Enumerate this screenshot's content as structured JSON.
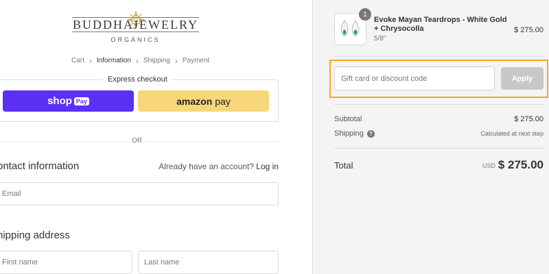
{
  "brand": {
    "word1": "BUDDHA",
    "word2": "JEWELRY",
    "sub": "ORGANICS",
    "colors": {
      "accent": "#c79a3b"
    }
  },
  "breadcrumb": {
    "items": [
      {
        "label": "Cart"
      },
      {
        "label": "Information",
        "current": true
      },
      {
        "label": "Shipping"
      },
      {
        "label": "Payment"
      }
    ],
    "separator_icon": "chevron-right-icon"
  },
  "express": {
    "title": "Express checkout",
    "shoppay_label": "shop",
    "shoppay_badge": "Pay",
    "amazon_label": "amazon",
    "amazon_pay": "pay",
    "colors": {
      "shoppay": "#5a31f4",
      "amazonpay": "#f8d67a"
    }
  },
  "divider": {
    "or": "OR"
  },
  "contact": {
    "title": "ontact information",
    "account_prompt": "Already have an account?",
    "login_link": "Log in",
    "email_placeholder": "Email"
  },
  "shipping_address": {
    "title": "hipping address",
    "first_name_placeholder": "First name",
    "last_name_placeholder": "Last name"
  },
  "order": {
    "product": {
      "name": "Evoke Mayan Teardrops - White Gold + Chrysocolla",
      "variant": "5/8\"",
      "price": "$ 275.00",
      "quantity": "1"
    },
    "discount": {
      "placeholder": "Gift card or discount code",
      "apply_label": "Apply",
      "highlight_color": "#f5a623"
    },
    "subtotal": {
      "label": "Subtotal",
      "value": "$ 275.00"
    },
    "shipping": {
      "label": "Shipping",
      "value": "Calculated at next step",
      "help_icon": "question-icon"
    },
    "total": {
      "label": "Total",
      "currency": "USD",
      "value": "$ 275.00"
    }
  }
}
